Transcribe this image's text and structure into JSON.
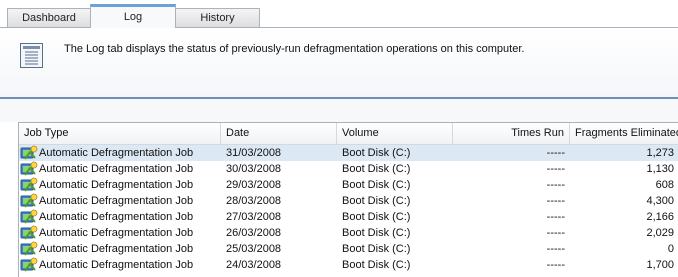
{
  "tabs": [
    {
      "label": "Dashboard"
    },
    {
      "label": "Log"
    },
    {
      "label": "History"
    }
  ],
  "active_tab": "Log",
  "info": {
    "text": "The Log tab displays the status of previously-run defragmentation operations on this computer."
  },
  "table": {
    "columns": [
      {
        "label": "Job Type"
      },
      {
        "label": "Date"
      },
      {
        "label": "Volume"
      },
      {
        "label": "Times Run"
      },
      {
        "label": "Fragments Eliminated"
      }
    ],
    "rows": [
      {
        "job": "Automatic Defragmentation Job",
        "date": "31/03/2008",
        "volume": "Boot Disk (C:)",
        "times": "-----",
        "fragments": "1,273",
        "selected": true
      },
      {
        "job": "Automatic Defragmentation Job",
        "date": "30/03/2008",
        "volume": "Boot Disk (C:)",
        "times": "-----",
        "fragments": "1,130"
      },
      {
        "job": "Automatic Defragmentation Job",
        "date": "29/03/2008",
        "volume": "Boot Disk (C:)",
        "times": "-----",
        "fragments": "608"
      },
      {
        "job": "Automatic Defragmentation Job",
        "date": "28/03/2008",
        "volume": "Boot Disk (C:)",
        "times": "-----",
        "fragments": "4,300"
      },
      {
        "job": "Automatic Defragmentation Job",
        "date": "27/03/2008",
        "volume": "Boot Disk (C:)",
        "times": "-----",
        "fragments": "2,166"
      },
      {
        "job": "Automatic Defragmentation Job",
        "date": "26/03/2008",
        "volume": "Boot Disk (C:)",
        "times": "-----",
        "fragments": "2,029"
      },
      {
        "job": "Automatic Defragmentation Job",
        "date": "25/03/2008",
        "volume": "Boot Disk (C:)",
        "times": "-----",
        "fragments": "0"
      },
      {
        "job": "Automatic Defragmentation Job",
        "date": "24/03/2008",
        "volume": "Boot Disk (C:)",
        "times": "-----",
        "fragments": "1,700"
      }
    ]
  },
  "colors": {
    "selected_row": "#dde8f5",
    "divider": "#6d8fb5",
    "active_tab_accent": "#6ea0d8"
  },
  "icons": {
    "info": "log-list-icon",
    "row": "defrag-job-icon"
  }
}
